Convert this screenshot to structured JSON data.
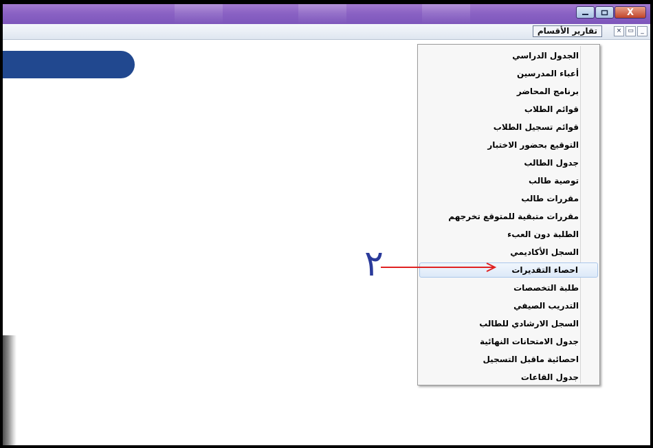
{
  "window": {
    "min_icon": "minimize-icon",
    "max_icon": "maximize-icon",
    "close_label": "X"
  },
  "menubar": {
    "menu_title": "تقارير الأقسام",
    "mdi_min": "_",
    "mdi_restore": "▭",
    "mdi_close": "×"
  },
  "menu": {
    "items": [
      "الجدول الدراسي",
      "أعباء المدرسين",
      "برنامج المحاضر",
      "قوائم الطلاب",
      "قوائم تسجيل الطلاب",
      "التوقيع بحضور الاختبار",
      "جدول الطالب",
      "توصية طالب",
      "مقررات طالب",
      "مقررات متبقية للمتوقع تخرجهم",
      "الطلبة دون العبء",
      "السجل الأكاديمي",
      "احصاء التقديرات",
      "طلبة التخصصات",
      "التدريب الصيفي",
      "السجل الارشادي للطالب",
      "جدول الامتحانات النهائية",
      "احصائية ماقبل التسجيل",
      "جدول القاعات"
    ],
    "highlighted_index": 12
  },
  "annotation": {
    "number": "٢",
    "color": "#e02020"
  },
  "colors": {
    "titlebar": "#8a62c4",
    "pill": "#21488f",
    "highlight": "#dde9f8"
  }
}
